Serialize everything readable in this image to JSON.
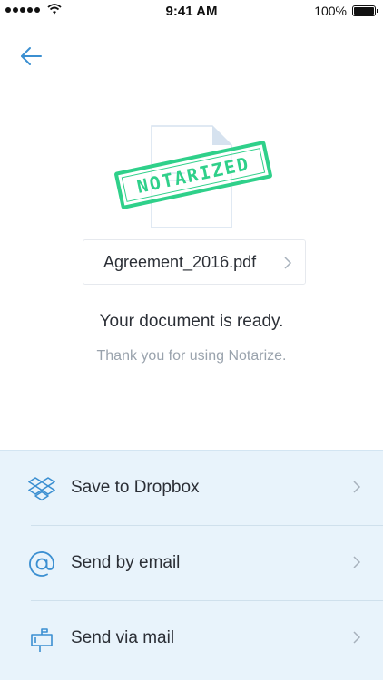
{
  "status_bar": {
    "time": "9:41 AM",
    "battery": "100%",
    "signal_icon": "signal-dots-icon",
    "wifi_icon": "wifi-icon",
    "battery_icon": "battery-icon"
  },
  "nav": {
    "back_icon": "arrow-left-icon"
  },
  "document": {
    "stamp_text": "NOTARIZED",
    "file_name": "Agreement_2016.pdf"
  },
  "message": {
    "headline": "Your document is ready.",
    "subline": "Thank you for using Notarize."
  },
  "actions": [
    {
      "label": "Save to Dropbox",
      "icon": "dropbox-icon"
    },
    {
      "label": "Send by email",
      "icon": "at-sign-icon"
    },
    {
      "label": "Send via mail",
      "icon": "mailbox-icon"
    }
  ],
  "colors": {
    "accent_blue": "#3b8fd1",
    "stamp_green": "#2fd08a",
    "panel_bg": "#e8f3fb",
    "muted_text": "#9aa3ad"
  }
}
